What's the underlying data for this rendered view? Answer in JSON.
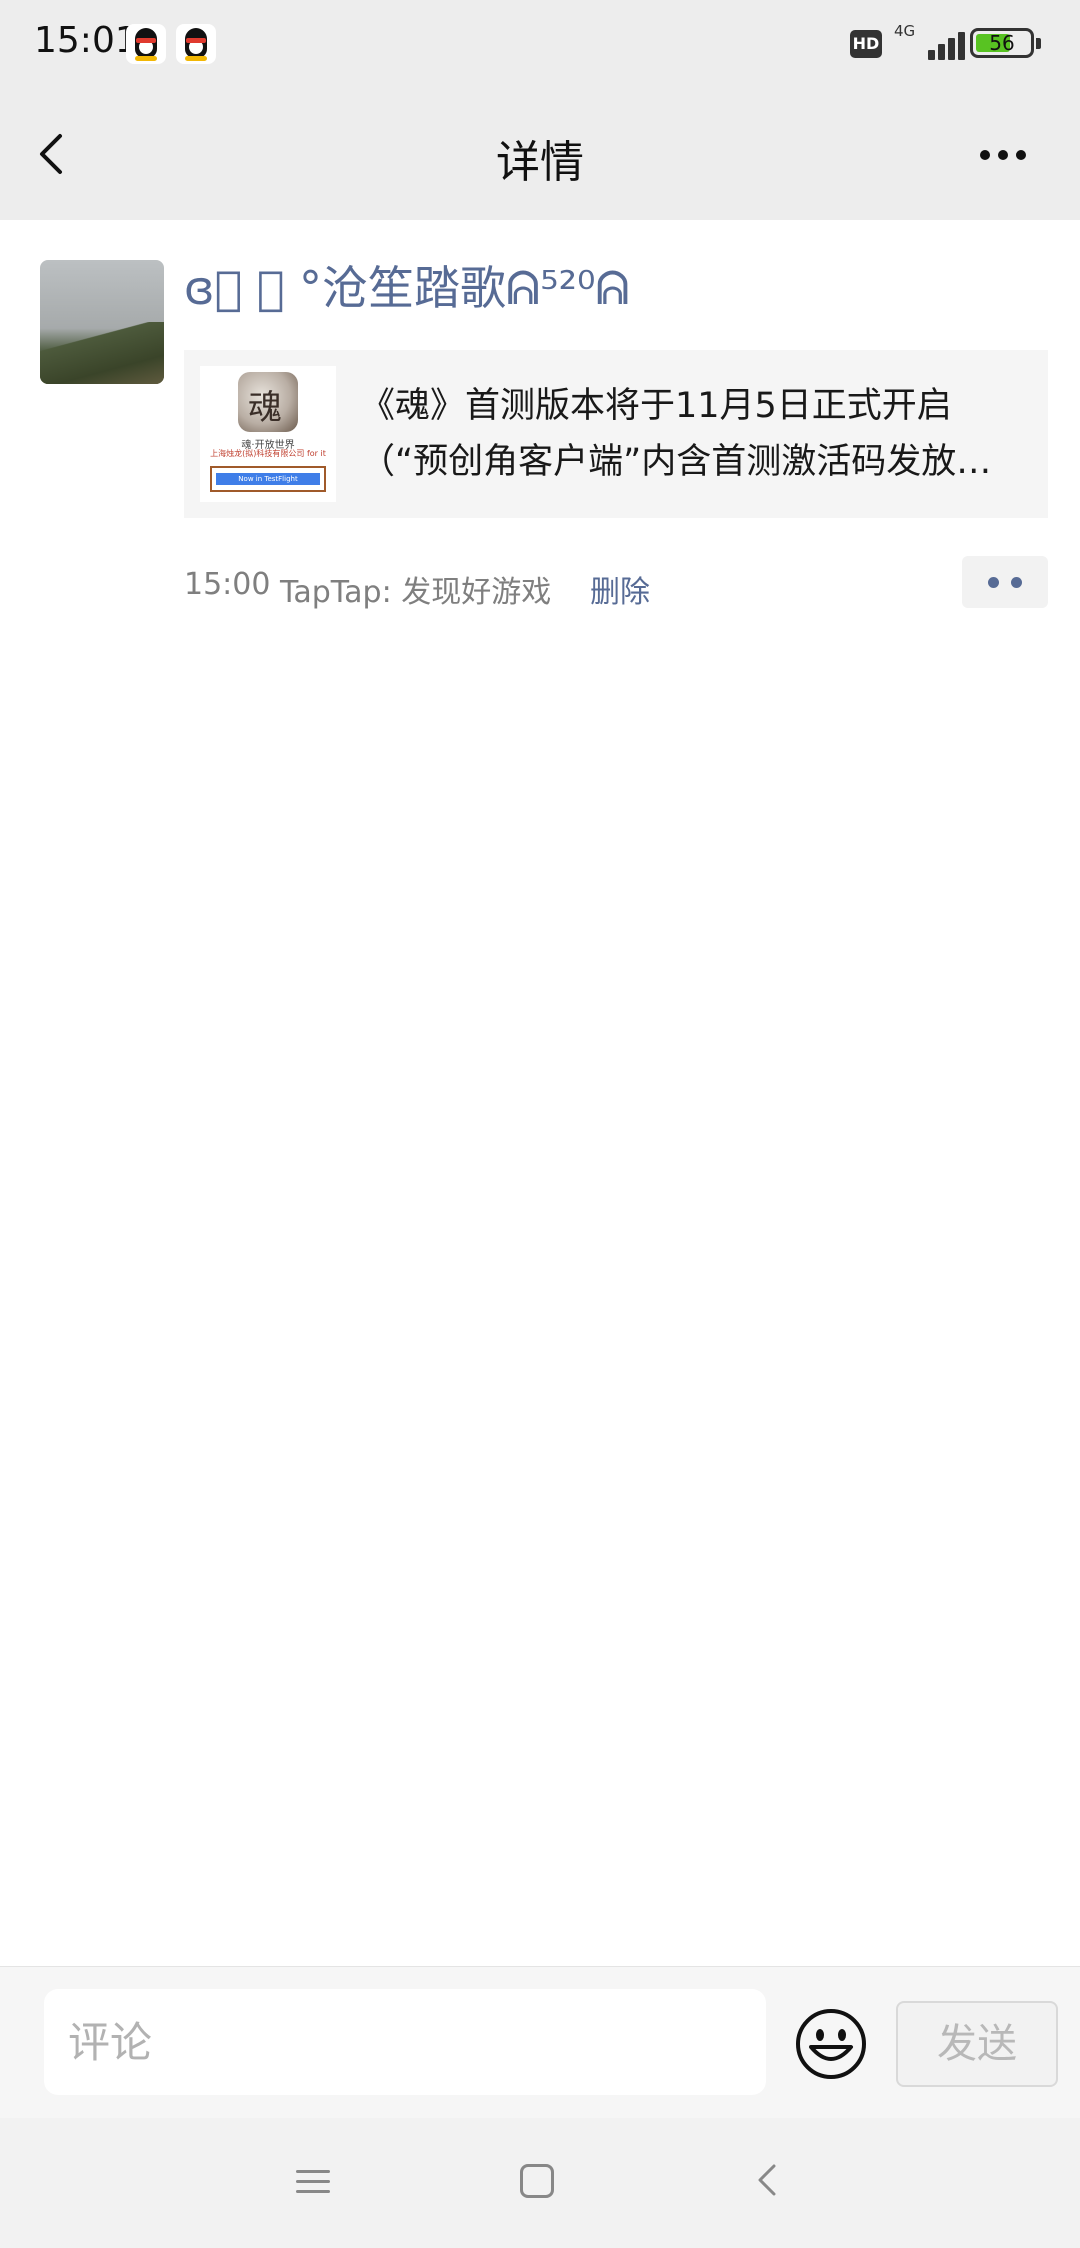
{
  "status_bar": {
    "time": "15:01",
    "hd": "HD",
    "network": "4G",
    "battery": "56",
    "notification_icons": [
      "qq-icon",
      "qq-icon"
    ]
  },
  "nav": {
    "title": "详情",
    "back_icon": "chevron-left-icon",
    "more_icon": "more-dots-icon"
  },
  "post": {
    "author": "ɞ᪲ ᪲ °沧笙踏歌ᕱ⁵²⁰ᕱ",
    "card": {
      "thumb_caption_1": "魂·开放世界",
      "thumb_caption_2": "上海烛龙(拟)科技有限公司 for it",
      "thumb_button": "Now in TestFlight",
      "title_line1": "《魂》首测版本将于11月5日正式开启",
      "title_line2": "（“预创角客户端”内含首测激活码发放…"
    },
    "time": "15:00",
    "source": "TapTap: 发现好游戏",
    "delete_label": "删除"
  },
  "comment_bar": {
    "placeholder": "评论",
    "send_label": "发送",
    "emoji_icon": "smiley-icon"
  },
  "system_nav": {
    "icons": [
      "menu-icon",
      "home-icon",
      "back-icon"
    ]
  }
}
